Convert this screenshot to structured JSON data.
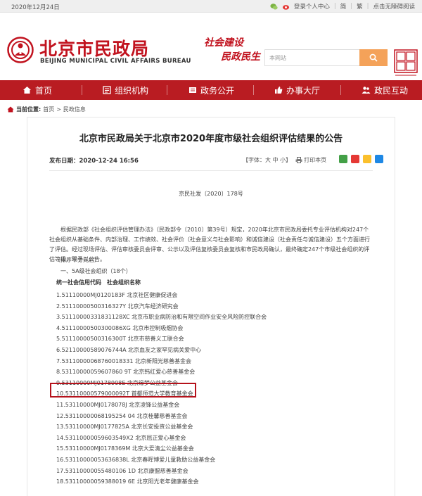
{
  "topbar": {
    "date": "2020年12月24日",
    "login": "登录个人中心",
    "simplified": "简",
    "traditional": "繁",
    "accessibility": "点击无障碍阅读"
  },
  "header": {
    "title_cn": "北京市民政局",
    "title_en": "BEIJING MUNICIPAL CIVIL AFFAIRS BUREAU",
    "slogan_line1": "社会建设",
    "slogan_line2": "民政民生",
    "search_placeholder": "本网站"
  },
  "nav": {
    "items": [
      "首页",
      "组织机构",
      "政务公开",
      "办事大厅",
      "政民互动"
    ]
  },
  "breadcrumb": {
    "label": "当前位置:",
    "home": "首页",
    "sep": ">",
    "section": "民政信息"
  },
  "article": {
    "title": "北京市民政局关于北京市2020年度市级社会组织评估结果的公告",
    "pubdate": "发布日期：2020-12-24 16:56",
    "font_label": "【字体：",
    "font_sizes": "大 中 小",
    "font_close": "】",
    "print": "打印本页",
    "doc_no": "京民社发〔2020〕178号",
    "para1": "根据民政部《社会组织评估管理办法》（民政部令〔2010〕第39号）规定，2020年北京市民政局委托专业评估机构对247个社会组织从基础条件、内部治理、工作绩效、社会评价（社会意义与社会影响）和诚信建设（社会责任与诚信建设）五个方面进行了评估。经过现场评估、评估审核委员会评审、公示以及评估复核委员会复核和市民政局确认，最终确定247个市级社会组织的评估等级，现予以公告。",
    "note": "（排序不分先后）",
    "section": "一、5A级社会组织（18个）",
    "list_header": "统一社会信用代码　社会组织名称",
    "list": [
      "1.51110000MJ0120183F  北京社区健康促进会",
      "2.51110000500316327Y  北京汽车经济研究会",
      "3.51110000331831128XC  北京市职业病防治和有限空间作业安全风险防控联合会",
      "4.51110000500300086XG  北京市控制吸烟协会",
      "5.51110000500316300T  北京市慈善义工联合会",
      "6.52110000589076744A  北京血友之家罕见病关爱中心",
      "7.53110000068760018331  北京新阳光慈善基金会",
      "8.53110000059607860 9T  北京韩红爱心慈善基金会",
      "9.53110000MJ0178908E  北京缘梦公益基金会",
      "10.53110000579000092T  首都师范大学教育基金会",
      "11.53110000MJ0178078J  北京凌锋公益基金会",
      "12.53110000068195254 04  北京桂馨慈善基金会",
      "13.53110000MJ0177825A  北京长安投资公益基金会",
      "14.53110000059603549X2  北京屈正爱心基金会",
      "15.53110000MJ0178369M  北京大爱清尘公益基金会",
      "16.53110000053636838L  北京春晖博爱儿童救助公益基金会",
      "17.53110000055480106 1D  北京康盟慈善基金会",
      "18.53110000059388019 6E  北京阳光老年健康基金会"
    ]
  },
  "colors": {
    "brand_red": "#b91c22",
    "search_orange": "#f4a259",
    "highlight_border": "#b5121b"
  }
}
